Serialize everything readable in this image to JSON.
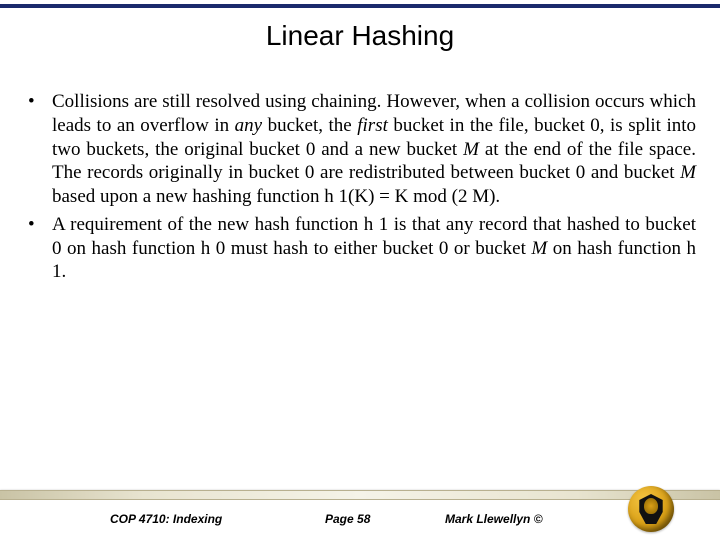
{
  "title": "Linear Hashing",
  "bullets": [
    {
      "pre": "Collisions are still resolved using chaining.  However, when a collision occurs which leads to an overflow in ",
      "em1": "any",
      "mid1": " bucket, the ",
      "em2": "first",
      "mid2": " bucket in the file, bucket 0, is split into two buckets, the original bucket 0 and a new bucket ",
      "em3": "M",
      "mid3": " at the end of the file space.  The records originally in bucket 0 are redistributed between bucket 0 and bucket ",
      "em4": "M",
      "post": " based upon a new hashing function h 1(K) = K mod (2 M)."
    },
    {
      "pre": "A requirement of the new hash function h 1 is that any record that hashed to bucket 0 on hash function h 0 must hash to either bucket 0 or bucket ",
      "em1": "M",
      "post": " on hash function h 1."
    }
  ],
  "footer": {
    "course": "COP 4710: Indexing",
    "page": "Page 58",
    "author": "Mark Llewellyn ©"
  },
  "logo": {
    "name": "ucf-pegasus-seal"
  }
}
